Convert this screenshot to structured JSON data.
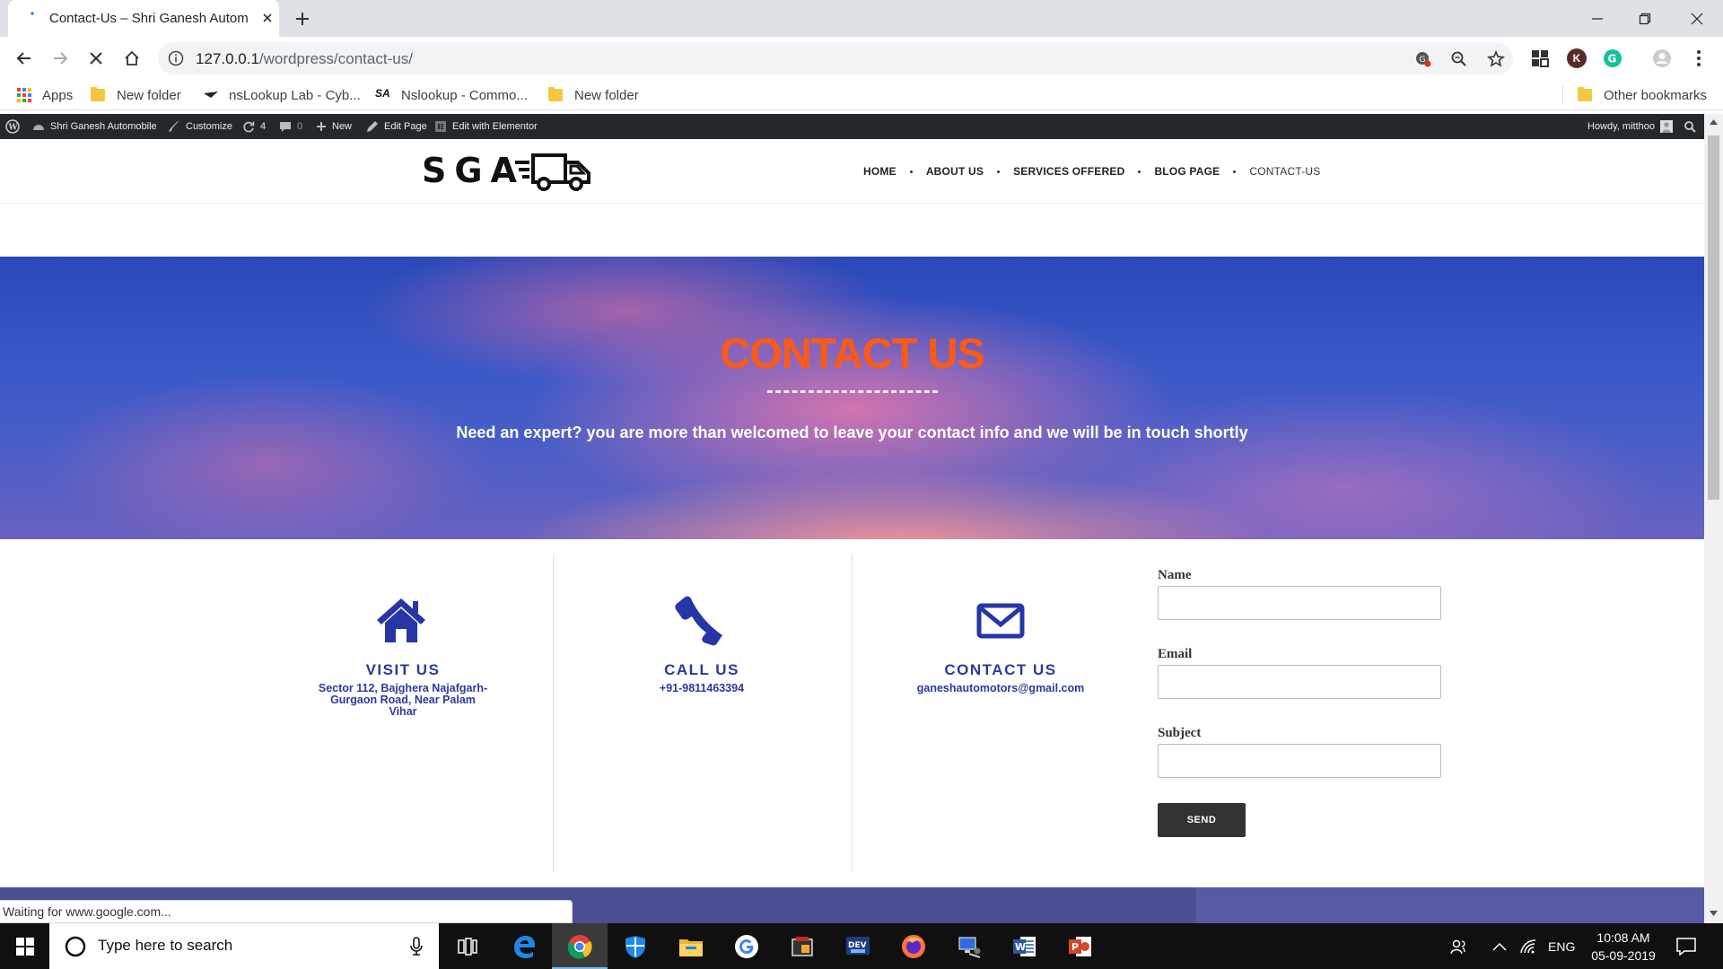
{
  "browser": {
    "tab_title": "Contact-Us – Shri Ganesh Autom",
    "url_host": "127.0.0.1",
    "url_path": "/wordpress/contact-us/",
    "profile_initial": "K",
    "bookmarks": [
      {
        "label": "Apps",
        "icon": "apps-grid-icon"
      },
      {
        "label": "New folder",
        "icon": "folder-icon"
      },
      {
        "label": "nsLookup Lab - Cyb...",
        "icon": "bookmark-site-icon"
      },
      {
        "label": "Nslookup - Commo...",
        "icon": "sa-logo-icon",
        "icon_text": "SA"
      },
      {
        "label": "New folder",
        "icon": "folder-icon"
      }
    ],
    "other_bookmarks": "Other bookmarks",
    "status_text": "Waiting for www.google.com..."
  },
  "admin_bar": {
    "site_name": "Shri Ganesh Automobile",
    "customize": "Customize",
    "updates_count": "4",
    "comments_count": "0",
    "new_label": "New",
    "edit_page": "Edit Page",
    "edit_elementor": "Edit with Elementor",
    "howdy": "Howdy, mitthoo"
  },
  "header": {
    "logo_text": "SGA",
    "nav": [
      "HOME",
      "ABOUT US",
      "SERVICES OFFERED",
      "BLOG PAGE",
      "CONTACT-US"
    ]
  },
  "hero": {
    "title": "CONTACT US",
    "subtitle": "Need an expert? you are more than welcomed to leave your contact info and we will be in touch shortly"
  },
  "contact_blocks": [
    {
      "title": "VISIT US",
      "icon": "home-icon",
      "detail_lines": [
        "Sector 112, Bajghera Najafgarh-",
        "Gurgaon Road, Near Palam",
        "Vihar"
      ]
    },
    {
      "title": "CALL US",
      "icon": "phone-icon",
      "detail_lines": [
        "+91-9811463394"
      ]
    },
    {
      "title": "CONTACT US",
      "icon": "envelope-icon",
      "detail_lines": [
        "ganeshautomotors@gmail.com"
      ]
    }
  ],
  "form": {
    "name_label": "Name",
    "name_value": "",
    "email_label": "Email",
    "email_value": "",
    "subject_label": "Subject",
    "subject_value": "",
    "send_label": "SEND"
  },
  "taskbar": {
    "search_placeholder": "Type here to search",
    "language": "ENG",
    "time": "10:08 AM",
    "date": "05-09-2019"
  },
  "colors": {
    "hero_title": "#ff5a14",
    "contact_blue": "#2b3a9b",
    "admin_bar": "#23282d",
    "send_button": "#333333"
  }
}
